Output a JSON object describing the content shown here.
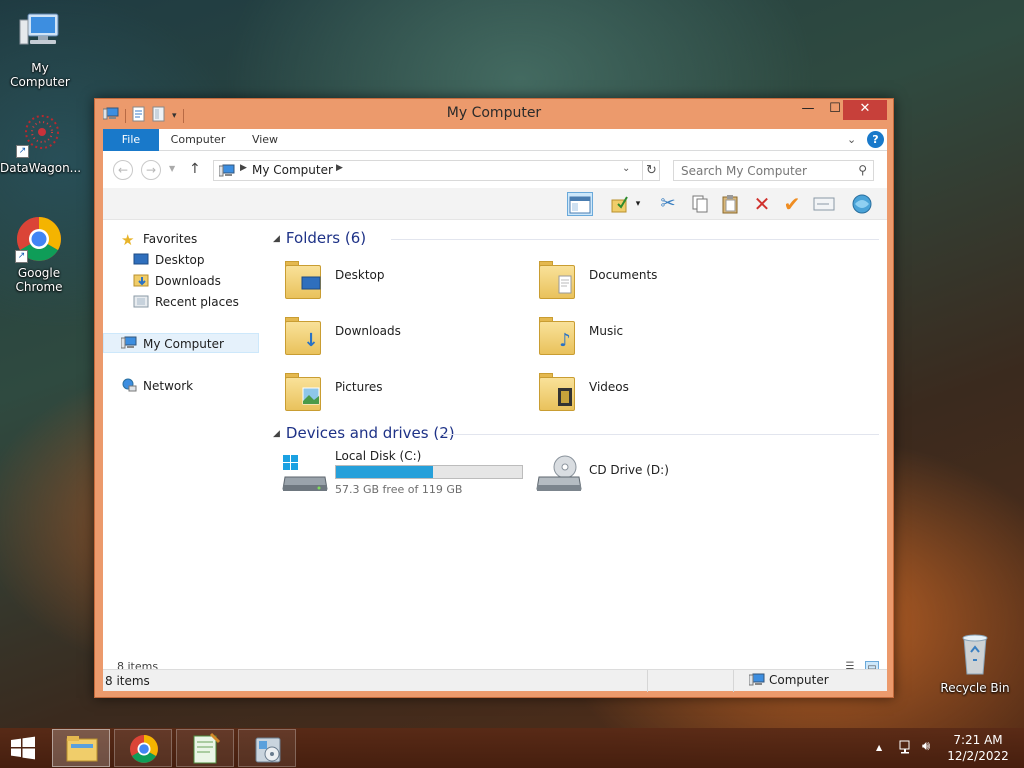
{
  "desktop": {
    "icons": [
      {
        "label": "My Computer",
        "icon": "computer-icon"
      },
      {
        "label": "DataWagon...",
        "icon": "datawagon-icon"
      },
      {
        "label": "Google Chrome",
        "icon": "chrome-icon"
      },
      {
        "label": "Recycle Bin",
        "icon": "recycle-bin-icon"
      }
    ]
  },
  "window": {
    "title": "My Computer",
    "controls": {
      "minimize": "—",
      "maximize": "☐",
      "close": "✕"
    },
    "tabs": [
      {
        "label": "File"
      },
      {
        "label": "Computer"
      },
      {
        "label": "View"
      }
    ],
    "address": {
      "crumb": "My Computer",
      "search_placeholder": "Search My Computer"
    },
    "toolbar_icons": [
      "preview-pane-icon",
      "select-icon",
      "cut-icon",
      "copy-icon",
      "paste-icon",
      "delete-icon",
      "check-icon",
      "rename-icon",
      "web-icon"
    ],
    "nav": {
      "favorites": {
        "label": "Favorites"
      },
      "favorites_items": [
        {
          "label": "Desktop"
        },
        {
          "label": "Downloads"
        },
        {
          "label": "Recent places"
        }
      ],
      "computer": {
        "label": "My Computer"
      },
      "network": {
        "label": "Network"
      }
    },
    "folders": {
      "header": "Folders (6)",
      "items": [
        {
          "label": "Desktop",
          "icon": "desktop-folder-icon"
        },
        {
          "label": "Documents",
          "icon": "documents-folder-icon"
        },
        {
          "label": "Downloads",
          "icon": "downloads-folder-icon"
        },
        {
          "label": "Music",
          "icon": "music-folder-icon"
        },
        {
          "label": "Pictures",
          "icon": "pictures-folder-icon"
        },
        {
          "label": "Videos",
          "icon": "videos-folder-icon"
        }
      ]
    },
    "drives": {
      "header": "Devices and drives (2)",
      "items": [
        {
          "label": "Local Disk (C:)",
          "free_text": "57.3 GB free of 119 GB",
          "used_fraction": 0.52
        },
        {
          "label": "CD Drive (D:)"
        }
      ]
    },
    "status": {
      "count_inline": "8 items",
      "count_bar": "8 items",
      "zone": "Computer"
    }
  },
  "taskbar": {
    "apps": [
      "file-explorer-icon",
      "chrome-icon",
      "notepad-icon",
      "control-panel-icon"
    ],
    "clock": {
      "time": "7:21 AM",
      "date": "12/2/2022"
    }
  },
  "colors": {
    "accent": "#1979ca",
    "window_frame": "#ec9a6c",
    "close_button": "#c7403a",
    "drive_bar": "#26a0da",
    "group_header": "#1e3287"
  }
}
